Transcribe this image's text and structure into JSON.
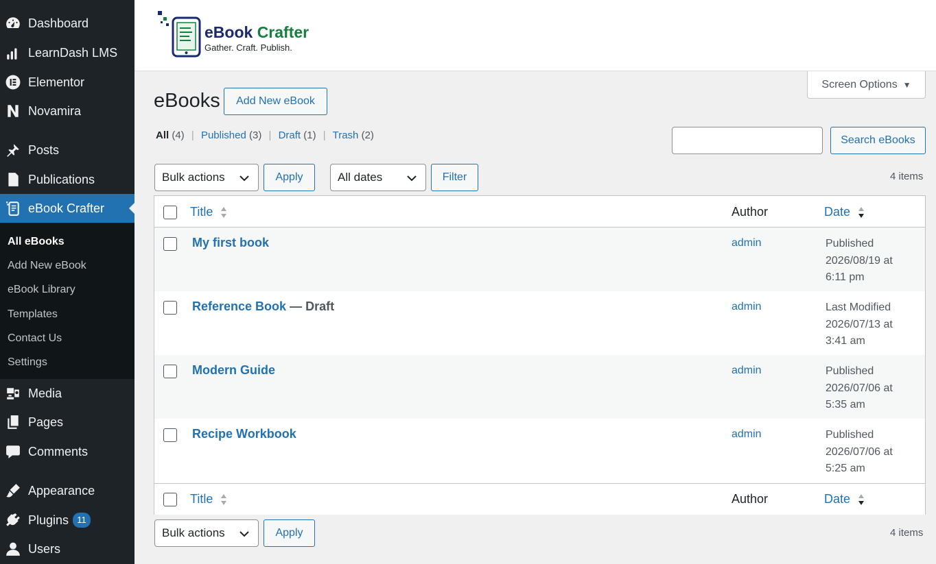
{
  "sidebar": {
    "items": [
      {
        "label": "Dashboard",
        "icon": "dashboard-icon"
      },
      {
        "label": "LearnDash LMS",
        "icon": "learndash-icon"
      },
      {
        "label": "Elementor",
        "icon": "elementor-icon"
      },
      {
        "label": "Novamira",
        "icon": "novamira-icon"
      },
      {
        "label": "Posts",
        "icon": "pin-icon"
      },
      {
        "label": "Publications",
        "icon": "publications-icon"
      },
      {
        "label": "eBook Crafter",
        "icon": "ebook-icon"
      },
      {
        "label": "Media",
        "icon": "media-icon"
      },
      {
        "label": "Pages",
        "icon": "pages-icon"
      },
      {
        "label": "Comments",
        "icon": "comments-icon"
      },
      {
        "label": "Appearance",
        "icon": "appearance-icon"
      },
      {
        "label": "Plugins",
        "icon": "plugins-icon",
        "badge": "11"
      },
      {
        "label": "Users",
        "icon": "users-icon"
      }
    ],
    "submenu": [
      "All eBooks",
      "Add New eBook",
      "eBook Library",
      "Templates",
      "Contact Us",
      "Settings"
    ]
  },
  "header": {
    "logo_word1": "eBook",
    "logo_word2": "Crafter",
    "tagline": "Gather. Craft. Publish."
  },
  "screen_options": "Screen Options",
  "page": {
    "title": "eBooks",
    "add_new": "Add New eBook"
  },
  "filters": {
    "all": "All",
    "all_count": "(4)",
    "published": "Published",
    "published_count": "(3)",
    "draft": "Draft",
    "draft_count": "(1)",
    "trash": "Trash",
    "trash_count": "(2)",
    "sep": "|"
  },
  "search": {
    "button": "Search eBooks",
    "value": ""
  },
  "toolbar": {
    "bulk_actions": "Bulk actions",
    "apply": "Apply",
    "all_dates": "All dates",
    "filter": "Filter",
    "items_count": "4 items"
  },
  "table": {
    "col_title": "Title",
    "col_author": "Author",
    "col_date": "Date",
    "rows": [
      {
        "title": "My first book",
        "state": "",
        "author": "admin",
        "date_status": "Published",
        "date_line1": "2026/08/19 at",
        "date_line2": "6:11 pm"
      },
      {
        "title": "Reference Book",
        "state": " — Draft",
        "author": "admin",
        "date_status": "Last Modified",
        "date_line1": "2026/07/13 at",
        "date_line2": "3:41 am"
      },
      {
        "title": "Modern Guide",
        "state": "",
        "author": "admin",
        "date_status": "Published",
        "date_line1": "2026/07/06 at",
        "date_line2": "5:35 am"
      },
      {
        "title": "Recipe Workbook",
        "state": "",
        "author": "admin",
        "date_status": "Published",
        "date_line1": "2026/07/06 at",
        "date_line2": "5:25 am"
      }
    ]
  },
  "colors": {
    "sidebar_bg": "#1d2327",
    "submenu_bg": "#101517",
    "accent": "#2271b1",
    "logo_navy": "#1a2a6c",
    "logo_green": "#15803d"
  }
}
